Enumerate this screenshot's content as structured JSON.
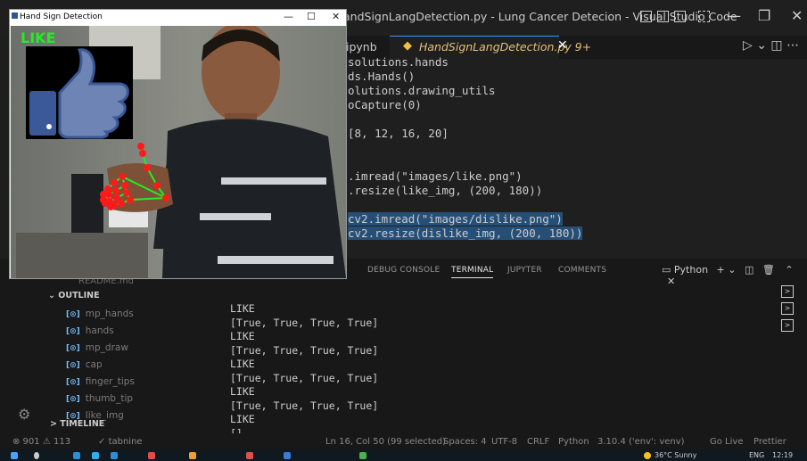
{
  "vscode": {
    "title": "HandSignLangDetection.py - Lung Cancer Detecion - Visual Studio Code",
    "title_visible": "andSignLangDetection.py - Lung Cancer Detecion - Visual Studio Code",
    "tabs": {
      "prev": "ipynb",
      "active": "HandSignLangDetection.py 9+"
    },
    "code_lines": [
      "solutions.hands",
      "ds.Hands()",
      "olutions.drawing_utils",
      "oCapture(0)",
      "",
      "[8, 12, 16, 20]",
      "",
      "",
      ".imread(\"images/like.png\")",
      ".resize(like_img, (200, 180))",
      "",
      "cv2.imread(\"images/dislike.png\")",
      "cv2.resize(dislike_img, (200, 180))"
    ],
    "panel_tabs": [
      "DEBUG CONSOLE",
      "TERMINAL",
      "JUPYTER",
      "COMMENTS"
    ],
    "python_label": "Python",
    "terminal_lines": [
      "LIKE",
      "[True, True, True, True]",
      "LIKE",
      "[True, True, True, True]",
      "LIKE",
      "[True, True, True, True]",
      "LIKE",
      "[True, True, True, True]",
      "LIKE",
      "[]"
    ],
    "outline": {
      "readme": "README.md",
      "header": "OUTLINE",
      "items": [
        "mp_hands",
        "hands",
        "mp_draw",
        "cap",
        "finger_tips",
        "thumb_tip",
        "like_img"
      ],
      "timeline": "TIMELINE"
    },
    "status": {
      "problems": "⊗ 901 ⚠ 113",
      "tabnine": "tabnine",
      "position": "Ln 16, Col 50 (99 selected)",
      "spaces": "Spaces: 4",
      "encoding": "UTF-8",
      "eol": "CRLF",
      "language": "Python",
      "interpreter": "3.10.4 ('env': venv)",
      "golive": "Go Live",
      "prettier": "Prettier"
    }
  },
  "camera_window": {
    "title": "Hand Sign Detection",
    "detected_label": "LIKE"
  },
  "taskbar": {
    "weather": "36°C Sunny",
    "lang": "ENG",
    "time": "12:19"
  },
  "colors": {
    "accent": "#3794ff",
    "landmark": "#ff1a1a",
    "connection": "#22ee22",
    "like_green": "#22ee22"
  }
}
